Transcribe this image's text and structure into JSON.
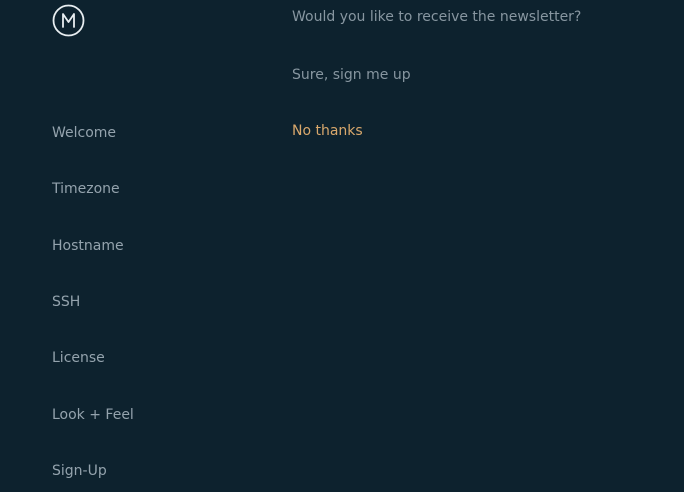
{
  "sidebar": {
    "items": [
      {
        "label": "Welcome"
      },
      {
        "label": "Timezone"
      },
      {
        "label": "Hostname"
      },
      {
        "label": "SSH"
      },
      {
        "label": "License"
      },
      {
        "label": "Look + Feel"
      },
      {
        "label": "Sign-Up"
      }
    ]
  },
  "main": {
    "question": "Would you like to receive the newsletter?",
    "options": [
      {
        "label": "Sure, sign me up"
      },
      {
        "label": "No thanks"
      }
    ]
  },
  "colors": {
    "background": "#0d222e",
    "text": "#94a3ad",
    "accent": "#d9a86c"
  }
}
